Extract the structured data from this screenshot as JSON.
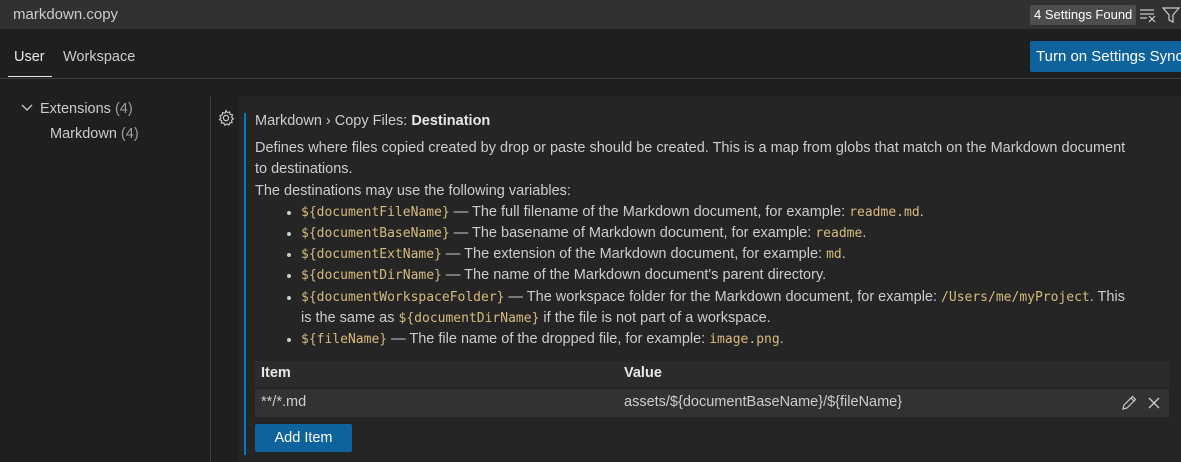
{
  "search": {
    "value": "markdown.copy",
    "results_badge": "4 Settings Found"
  },
  "tabs": [
    {
      "label": "User",
      "active": true
    },
    {
      "label": "Workspace",
      "active": false
    }
  ],
  "sync_button_label": "Turn on Settings Sync",
  "tree": {
    "extensions_label": "Extensions",
    "extensions_count": "(4)",
    "markdown_label": "Markdown",
    "markdown_count": "(4)"
  },
  "setting": {
    "category": "Markdown › Copy Files: ",
    "name": "Destination",
    "description_lines": [
      "Defines where files copied created by drop or paste should be created. This is a map from globs that match on the Markdown document",
      "to destinations.",
      "The destinations may use the following variables:"
    ],
    "variables": [
      {
        "code": "${documentFileName}",
        "text": " — The full filename of the Markdown document, for example: ",
        "example": "readme.md",
        "end": "."
      },
      {
        "code": "${documentBaseName}",
        "text": " — The basename of Markdown document, for example: ",
        "example": "readme",
        "end": "."
      },
      {
        "code": "${documentExtName}",
        "text": " — The extension of the Markdown document, for example: ",
        "example": "md",
        "end": "."
      },
      {
        "code": "${documentDirName}",
        "text": " — The name of the Markdown document's parent directory.",
        "example": "",
        "end": ""
      },
      {
        "code": "${documentWorkspaceFolder}",
        "text": " — The workspace folder for the Markdown document, for example: ",
        "example": "/Users/me/myProject",
        "end": ". This"
      },
      {
        "code": "${fileName}",
        "text": " — The file name of the dropped file, for example: ",
        "example": "image.png",
        "end": "."
      }
    ],
    "workspace_continuation": {
      "pre": "is the same as ",
      "code": "${documentDirName}",
      "post": " if the file is not part of a workspace."
    },
    "table": {
      "headers": [
        "Item",
        "Value"
      ],
      "rows": [
        {
          "item": "**/*.md",
          "value": "assets/${documentBaseName}/${fileName}"
        }
      ]
    },
    "add_item_label": "Add Item"
  },
  "colors": {
    "accent": "#007acc",
    "button": "#0e639c",
    "code": "#d7ba7d",
    "background": "#1f1f1f"
  }
}
